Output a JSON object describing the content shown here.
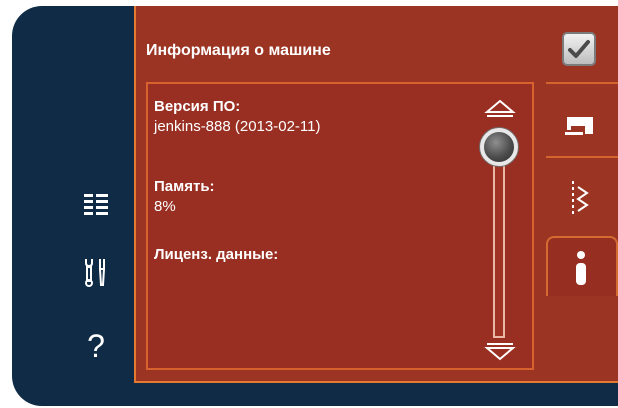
{
  "sidebar": {
    "items": [
      {
        "icon": "list-icon"
      },
      {
        "icon": "tools-icon"
      },
      {
        "icon": "help-icon",
        "label": "?"
      }
    ]
  },
  "panel": {
    "title": "Информация о машине",
    "fields": [
      {
        "label": "Версия ПО:",
        "value": "jenkins-888 (2013-02-11)"
      },
      {
        "label": "Память:",
        "value": "8%"
      },
      {
        "label": "Лиценз. данные:",
        "value": ""
      }
    ]
  },
  "tabs": [
    {
      "icon": "checkmark-icon"
    },
    {
      "icon": "sewing-machine-icon"
    },
    {
      "icon": "zigzag-stitch-icon"
    },
    {
      "icon": "info-icon",
      "active": true
    }
  ],
  "colors": {
    "background": "#0f2b46",
    "panel": "#9b3423",
    "accent": "#e47a30"
  }
}
